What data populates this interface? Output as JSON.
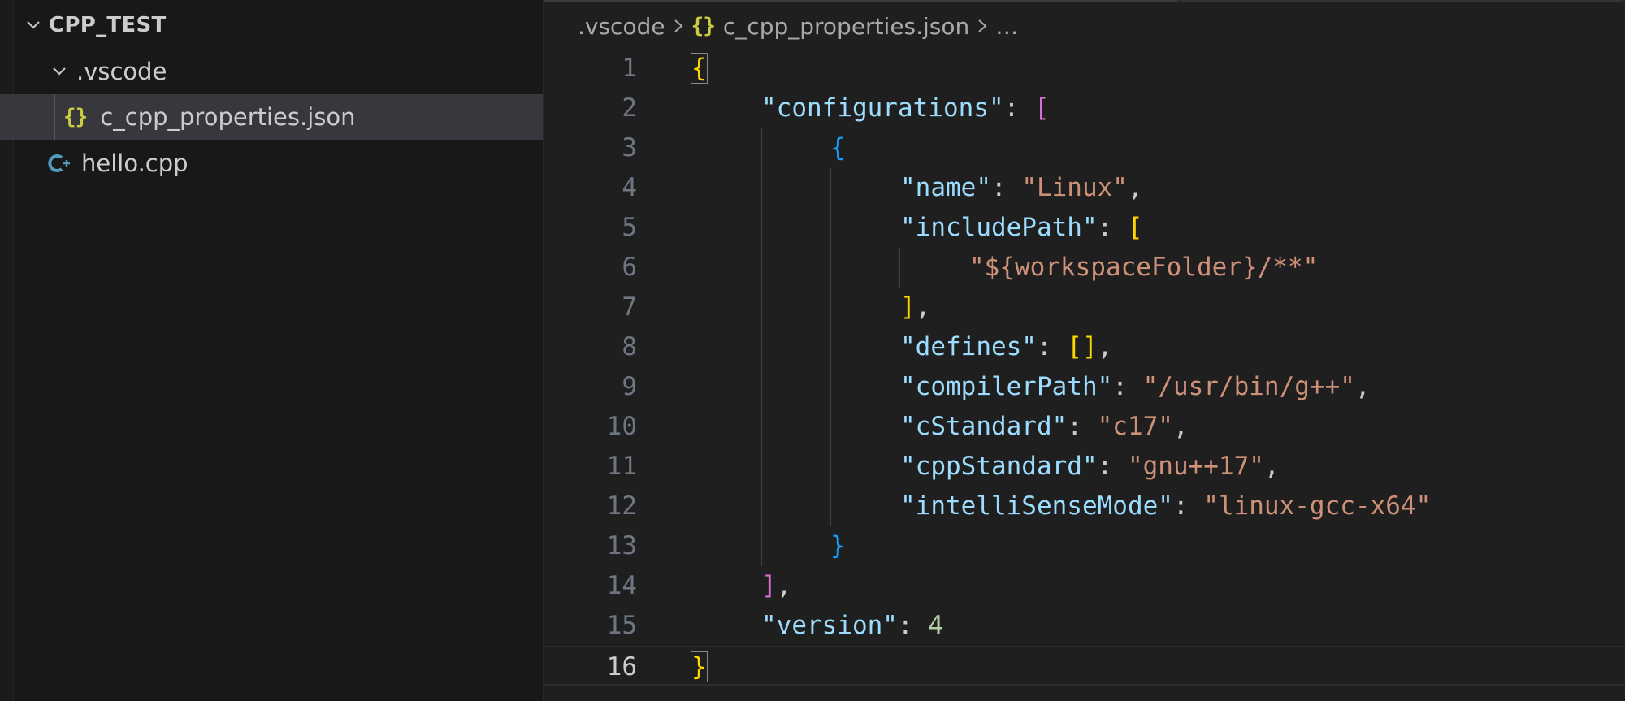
{
  "explorer": {
    "root_label": "CPP_TEST",
    "items": [
      {
        "label": ".vscode",
        "type": "folder",
        "expanded": true
      },
      {
        "label": "c_cpp_properties.json",
        "type": "file",
        "icon": "json-braces-icon",
        "selected": true
      },
      {
        "label": "hello.cpp",
        "type": "file",
        "icon": "cpp-icon"
      }
    ],
    "json_glyph": "{}"
  },
  "breadcrumb": {
    "folder": ".vscode",
    "file_glyph": "{}",
    "file": "c_cpp_properties.json",
    "ellipsis": "…"
  },
  "editor": {
    "current_line": 16,
    "line_numbers": [
      "1",
      "2",
      "3",
      "4",
      "5",
      "6",
      "7",
      "8",
      "9",
      "10",
      "11",
      "12",
      "13",
      "14",
      "15",
      "16"
    ],
    "lines": [
      [
        {
          "t": "{",
          "c": "b1"
        }
      ],
      [
        {
          "t": "\"configurations\"",
          "c": "key"
        },
        {
          "t": ": ",
          "c": "punc"
        },
        {
          "t": "[",
          "c": "b2"
        }
      ],
      [
        {
          "t": "{",
          "c": "b3"
        }
      ],
      [
        {
          "t": "\"name\"",
          "c": "key"
        },
        {
          "t": ": ",
          "c": "punc"
        },
        {
          "t": "\"Linux\"",
          "c": "str"
        },
        {
          "t": ",",
          "c": "punc"
        }
      ],
      [
        {
          "t": "\"includePath\"",
          "c": "key"
        },
        {
          "t": ": ",
          "c": "punc"
        },
        {
          "t": "[",
          "c": "b1"
        }
      ],
      [
        {
          "t": "\"${workspaceFolder}/**\"",
          "c": "str"
        }
      ],
      [
        {
          "t": "]",
          "c": "b1"
        },
        {
          "t": ",",
          "c": "punc"
        }
      ],
      [
        {
          "t": "\"defines\"",
          "c": "key"
        },
        {
          "t": ": ",
          "c": "punc"
        },
        {
          "t": "[]",
          "c": "b1"
        },
        {
          "t": ",",
          "c": "punc"
        }
      ],
      [
        {
          "t": "\"compilerPath\"",
          "c": "key"
        },
        {
          "t": ": ",
          "c": "punc"
        },
        {
          "t": "\"/usr/bin/g++\"",
          "c": "str"
        },
        {
          "t": ",",
          "c": "punc"
        }
      ],
      [
        {
          "t": "\"cStandard\"",
          "c": "key"
        },
        {
          "t": ": ",
          "c": "punc"
        },
        {
          "t": "\"c17\"",
          "c": "str"
        },
        {
          "t": ",",
          "c": "punc"
        }
      ],
      [
        {
          "t": "\"cppStandard\"",
          "c": "key"
        },
        {
          "t": ": ",
          "c": "punc"
        },
        {
          "t": "\"gnu++17\"",
          "c": "str"
        },
        {
          "t": ",",
          "c": "punc"
        }
      ],
      [
        {
          "t": "\"intelliSenseMode\"",
          "c": "key"
        },
        {
          "t": ": ",
          "c": "punc"
        },
        {
          "t": "\"linux-gcc-x64\"",
          "c": "str"
        }
      ],
      [
        {
          "t": "}",
          "c": "b3"
        }
      ],
      [
        {
          "t": "]",
          "c": "b2"
        },
        {
          "t": ",",
          "c": "punc"
        }
      ],
      [
        {
          "t": "\"version\"",
          "c": "key"
        },
        {
          "t": ": ",
          "c": "punc"
        },
        {
          "t": "4",
          "c": "num"
        }
      ],
      [
        {
          "t": "}",
          "c": "b1"
        }
      ]
    ]
  },
  "colors": {
    "background": "#1f1f1f",
    "sidebar": "#181818",
    "selection": "#37373d",
    "json_key": "#9cdcfe",
    "json_string": "#ce9178",
    "json_number": "#b5cea8",
    "bracket_gold": "#ffd700",
    "bracket_orchid": "#da70d6",
    "bracket_blue": "#179fff",
    "cpp_icon": "#519aba",
    "json_icon": "#cbcb41"
  }
}
